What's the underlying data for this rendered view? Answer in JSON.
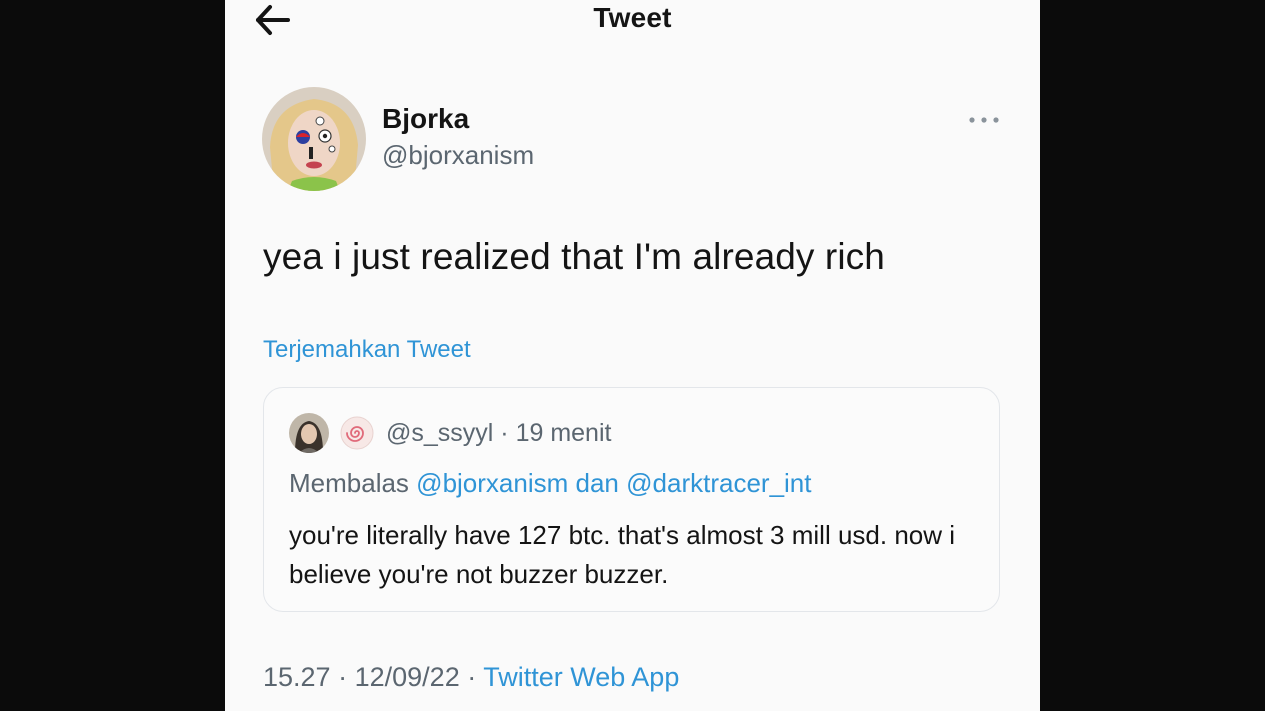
{
  "header": {
    "title": "Tweet",
    "back_icon": "arrow-left-icon"
  },
  "tweet": {
    "author": {
      "display_name": "Bjorka",
      "handle": "@bjorxanism"
    },
    "more_icon": "more-horizontal-icon",
    "text": "yea i just realized that I'm already rich",
    "translate_label": "Terjemahkan Tweet",
    "time": "15.27",
    "separator": "·",
    "date": "12/09/22",
    "source": "Twitter Web App"
  },
  "quoted_reply": {
    "handle": "@s_ssyyl",
    "separator": "·",
    "age": "19 menit",
    "emoji_icon": "swirl-emoji-icon",
    "replying_prefix": "Membalas",
    "mention_1": "@bjorxanism",
    "conjunction": "dan",
    "mention_2": "@darktracer_int",
    "text": "you're literally have 127 btc. that's almost 3 mill usd. now i believe you're not buzzer buzzer."
  },
  "colors": {
    "link": "#2f94d6",
    "text_primary": "#141414",
    "text_secondary": "#5b6670",
    "background": "#fafafa",
    "border": "#e3e6ea"
  }
}
